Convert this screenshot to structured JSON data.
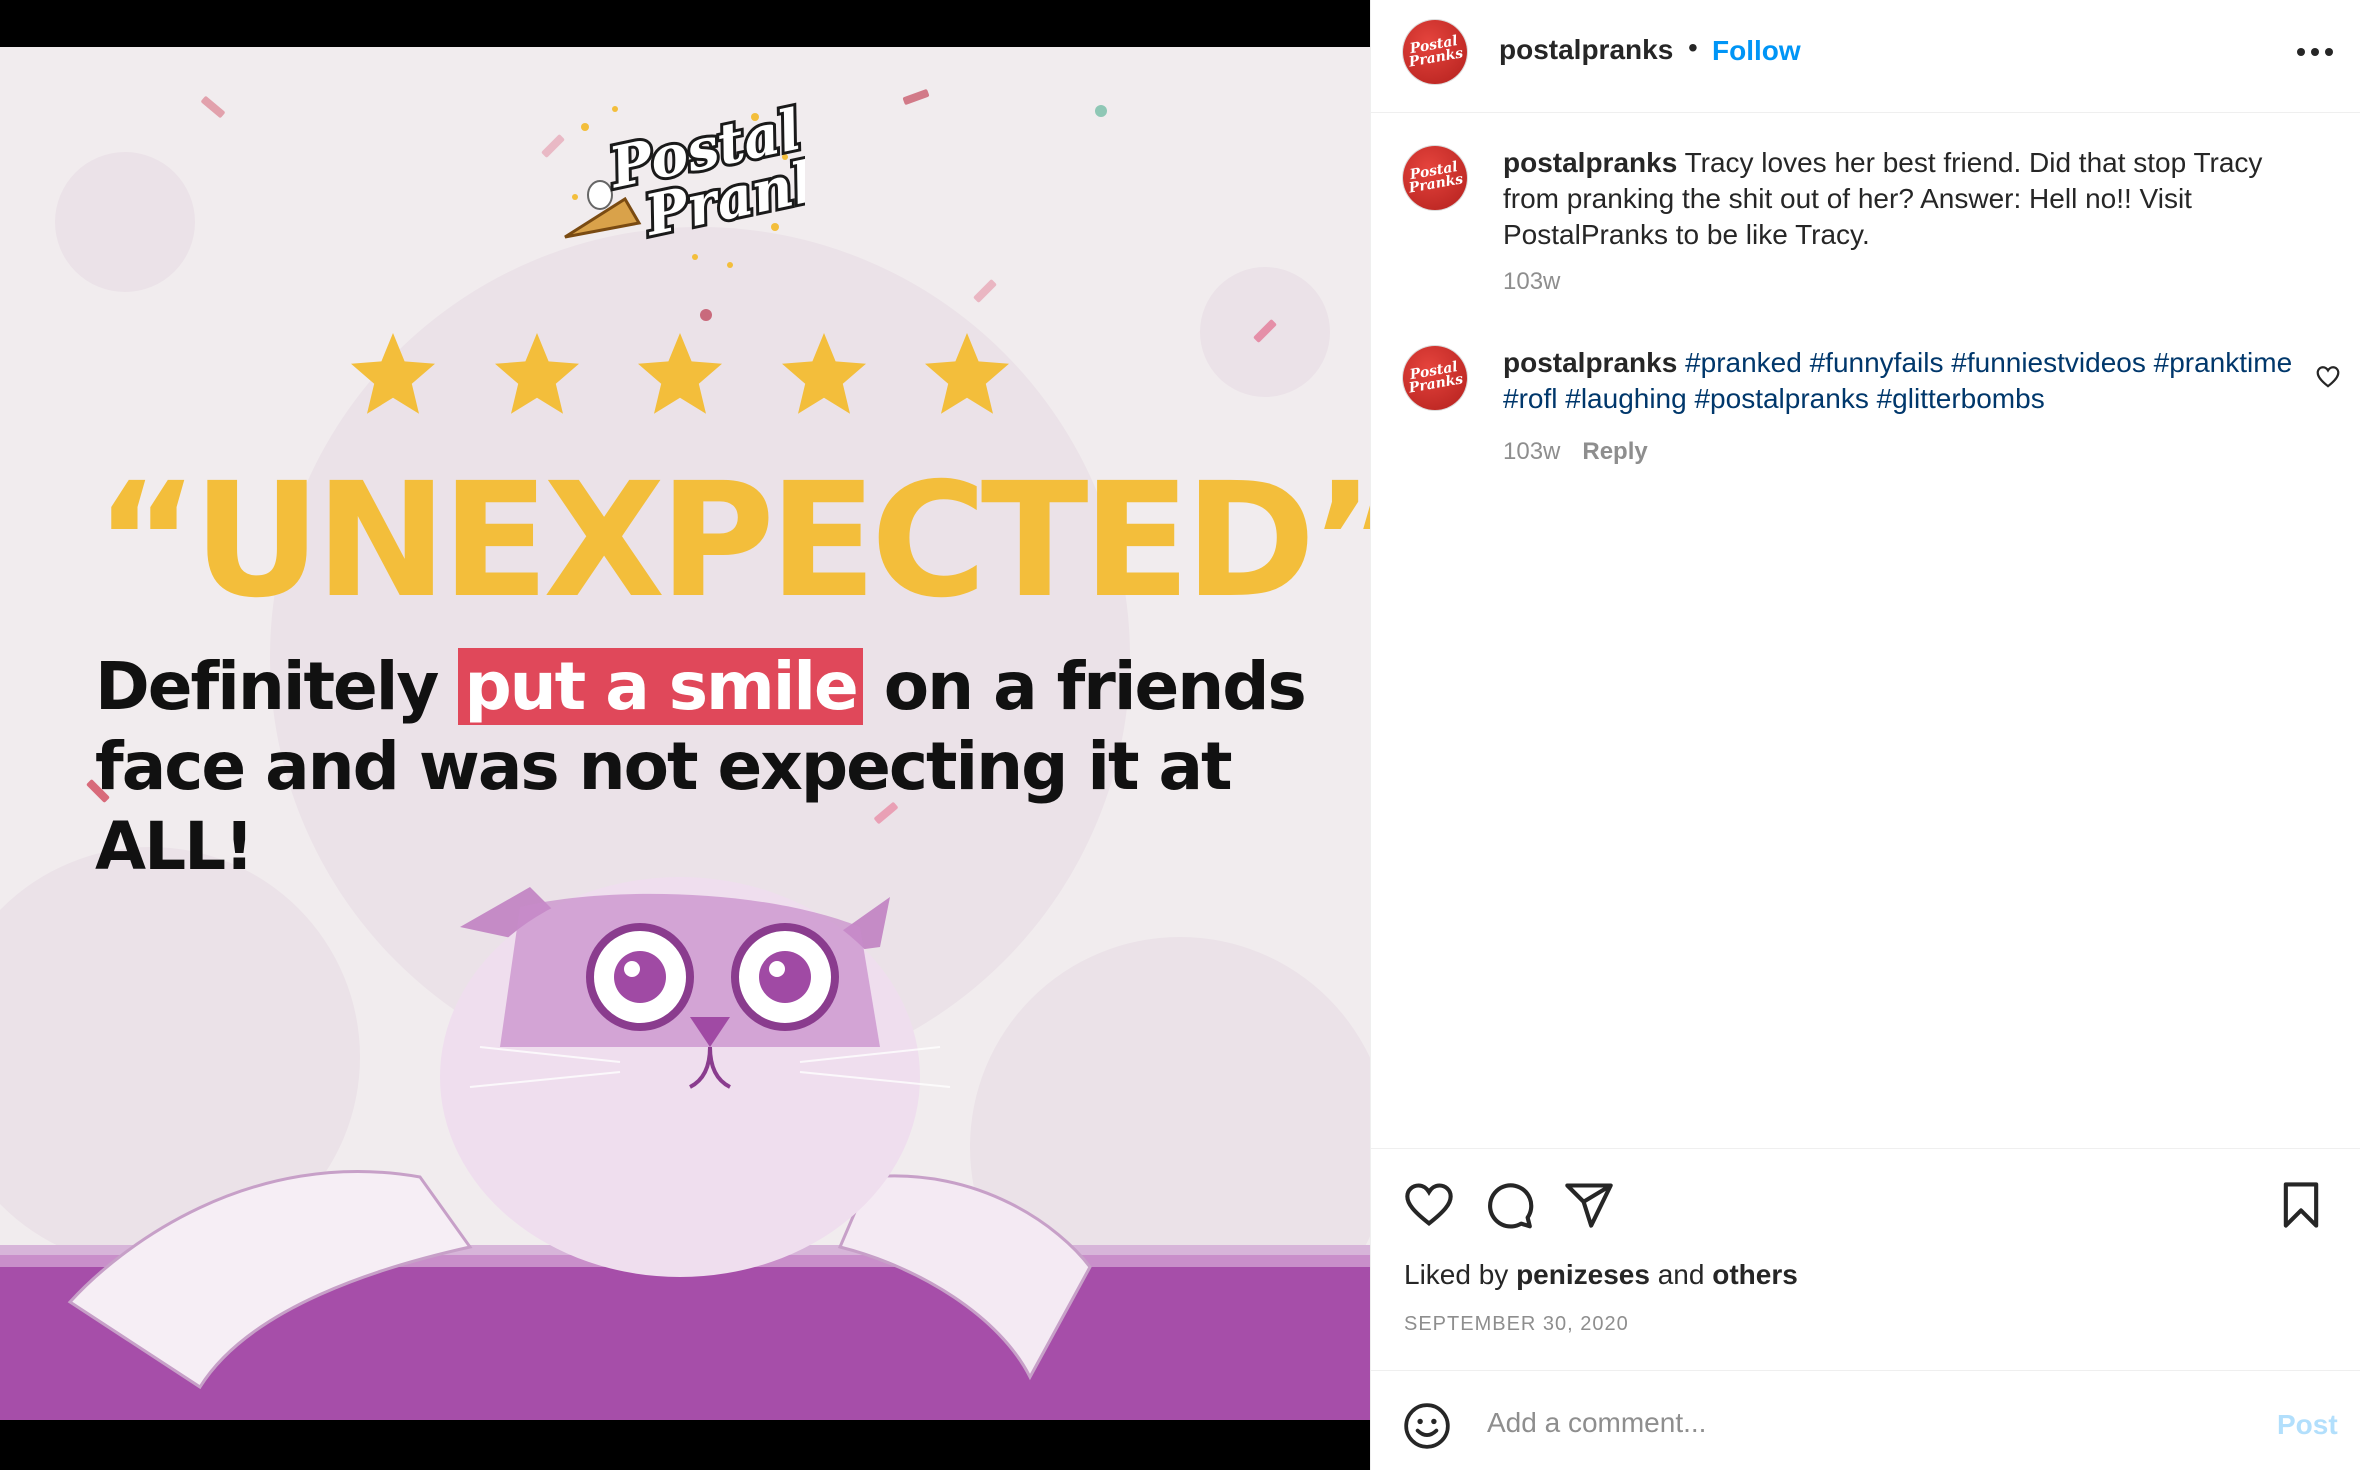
{
  "post": {
    "headline": "“UNEXPECTED”",
    "subtitle_before": "Definitely ",
    "subtitle_highlight": "put a smile",
    "subtitle_after": " on a friends face and was not expecting it at ALL!",
    "logo_line1": "Postal",
    "logo_line2": "Pranks",
    "rating_stars": 5,
    "colors": {
      "headline": "#f3be3b",
      "highlight": "#e0485a",
      "cat_tint": "#b159b8",
      "background": "#f1ecee"
    }
  },
  "header": {
    "avatar_text": "Postal Pranks",
    "username": "postalpranks",
    "separator": "•",
    "follow_label": "Follow"
  },
  "comments": [
    {
      "username": "postalpranks",
      "text": "Tracy loves her best friend. Did that stop Tracy from pranking the shit out of her? Answer: Hell no!! Visit PostalPranks to be like Tracy.",
      "time": "103w"
    },
    {
      "username": "postalpranks",
      "hashtags": [
        "#pranked",
        "#funnyfails",
        "#funniestvideos",
        "#pranktime",
        "#rofl",
        "#laughing",
        "#postalpranks",
        "#glitterbombs"
      ],
      "time": "103w",
      "reply_label": "Reply"
    }
  ],
  "actions": {
    "icons": [
      "heart-icon",
      "comment-icon",
      "share-icon",
      "bookmark-icon"
    ]
  },
  "likes": {
    "prefix": "Liked by",
    "user": "penizeses",
    "and": "and",
    "others": "others"
  },
  "date": "SEPTEMBER 30, 2020",
  "comment_box": {
    "placeholder": "Add a comment...",
    "post_label": "Post"
  }
}
